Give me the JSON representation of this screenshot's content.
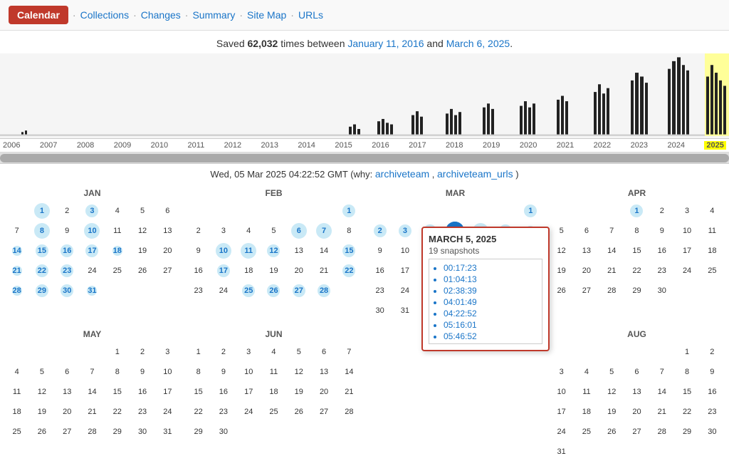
{
  "nav": {
    "calendar_label": "Calendar",
    "links": [
      "Collections",
      "Changes",
      "Summary",
      "Site Map",
      "URLs"
    ]
  },
  "saved": {
    "prefix": "Saved ",
    "count": "62,032",
    "suffix": " times between ",
    "date1": "January 11, 2016",
    "date2": "March 6, 2025",
    "end": "."
  },
  "gmt": {
    "text": "Wed, 05 Mar 2025 04:22:52 GMT",
    "why_label": "why:",
    "links": [
      "archiveteam",
      "archiveteam_urls"
    ]
  },
  "years": [
    "2006",
    "2007",
    "2008",
    "2009",
    "2010",
    "2011",
    "2012",
    "2013",
    "2014",
    "2015",
    "2016",
    "2017",
    "2018",
    "2019",
    "2020",
    "2021",
    "2022",
    "2023",
    "2024",
    "2025"
  ],
  "popup": {
    "title": "MARCH 5, 2025",
    "snapshot_count": "19 snapshots",
    "times": [
      "00:17:23",
      "01:04:13",
      "02:38:39",
      "04:01:49",
      "04:22:52",
      "05:16:01",
      "05:46:52"
    ]
  },
  "months": [
    {
      "name": "JAN",
      "days": [
        [
          null,
          1,
          2,
          3,
          4,
          5,
          6
        ],
        [
          7,
          8,
          9,
          10,
          11,
          12,
          13
        ],
        [
          14,
          15,
          16,
          17,
          18,
          19,
          20
        ],
        [
          21,
          22,
          23,
          24,
          25,
          26,
          27
        ],
        [
          28,
          29,
          30,
          31,
          null,
          null,
          null
        ]
      ],
      "highlighted": [
        1,
        3,
        8,
        10,
        15,
        16,
        17,
        22,
        23,
        29,
        30
      ]
    },
    {
      "name": "FEB",
      "days": [
        [
          null,
          null,
          null,
          null,
          null,
          null,
          1
        ],
        [
          2,
          3,
          4,
          5,
          6,
          7,
          8
        ],
        [
          9,
          10,
          11,
          12,
          13,
          14,
          15
        ],
        [
          16,
          17,
          18,
          19,
          20,
          21,
          22
        ],
        [
          23,
          24,
          25,
          26,
          27,
          28,
          null
        ]
      ],
      "highlighted": [
        1,
        6,
        7,
        10,
        11,
        12,
        15,
        17,
        22,
        25,
        26,
        27,
        28
      ]
    },
    {
      "name": "MAY",
      "days": [
        [
          null,
          null,
          null,
          null,
          1,
          2,
          3
        ],
        [
          4,
          5,
          6,
          7,
          8,
          9,
          10
        ],
        [
          11,
          12,
          13,
          14,
          15,
          16,
          17
        ],
        [
          18,
          19,
          20,
          21,
          22,
          23,
          24
        ],
        [
          25,
          26,
          27,
          28,
          29,
          30,
          31
        ]
      ],
      "highlighted": []
    },
    {
      "name": "APR",
      "days": [
        [
          null,
          null,
          1,
          2,
          3,
          4,
          5
        ],
        [
          6,
          7,
          8,
          9,
          10,
          11,
          12
        ],
        [
          13,
          14,
          15,
          16,
          17,
          18,
          19
        ],
        [
          20,
          21,
          22,
          23,
          24,
          25,
          26
        ],
        [
          27,
          28,
          29,
          30,
          null,
          null,
          null
        ]
      ],
      "highlighted": [
        1
      ]
    }
  ]
}
